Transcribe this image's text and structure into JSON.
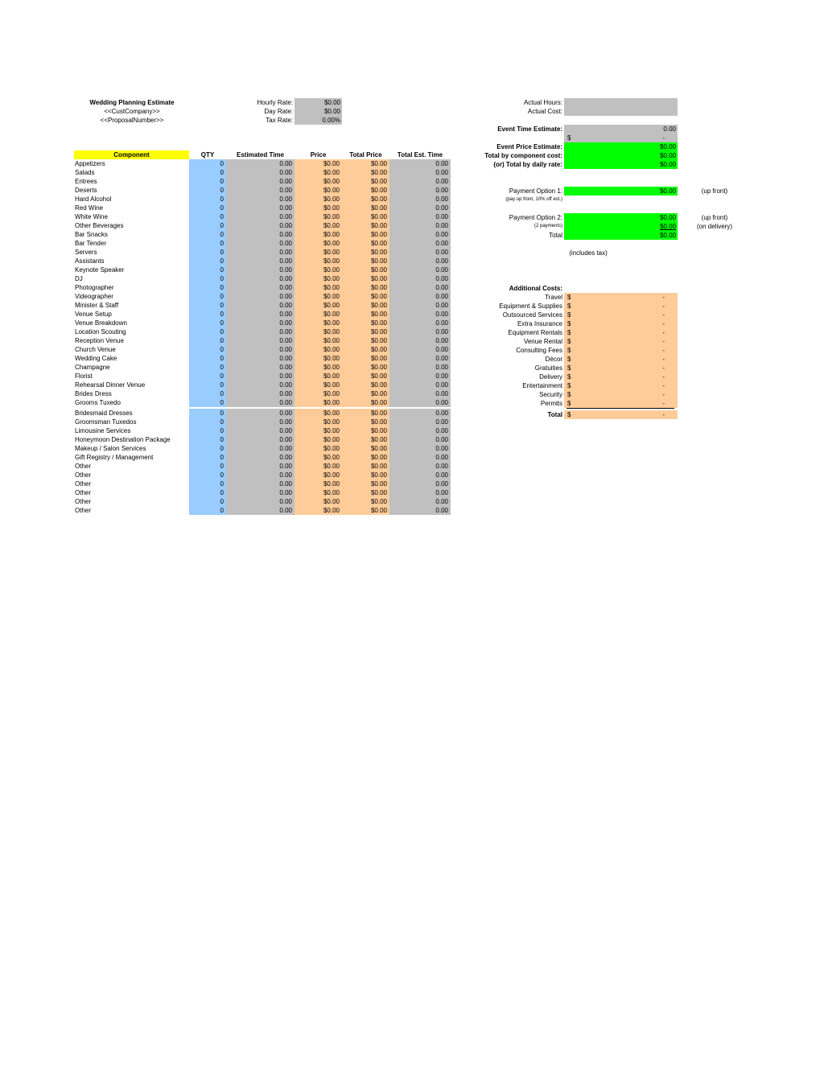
{
  "header": {
    "title": "Wedding Planning Estimate",
    "company": "<<CustCompany>>",
    "proposal": "<<ProposalNumber>>"
  },
  "rates": [
    {
      "label": "Hourly Rate:",
      "value": "$0.00"
    },
    {
      "label": "Day Rate:",
      "value": "$0.00"
    },
    {
      "label": "Tax Rate:",
      "value": "0.00%"
    }
  ],
  "table": {
    "columns": [
      "Component",
      "QTY",
      "Estimated Time",
      "Price",
      "Total Price",
      "Total Est. Time"
    ],
    "rows": [
      {
        "component": "Appetizers",
        "qty": "0",
        "est_time": "0.00",
        "price": "$0.00",
        "total_price": "$0.00",
        "total_est_time": "0.00"
      },
      {
        "component": "Salads",
        "qty": "0",
        "est_time": "0.00",
        "price": "$0.00",
        "total_price": "$0.00",
        "total_est_time": "0.00"
      },
      {
        "component": "Entrees",
        "qty": "0",
        "est_time": "0.00",
        "price": "$0.00",
        "total_price": "$0.00",
        "total_est_time": "0.00"
      },
      {
        "component": "Deserts",
        "qty": "0",
        "est_time": "0.00",
        "price": "$0.00",
        "total_price": "$0.00",
        "total_est_time": "0.00"
      },
      {
        "component": "Hard Alcohol",
        "qty": "0",
        "est_time": "0.00",
        "price": "$0.00",
        "total_price": "$0.00",
        "total_est_time": "0.00"
      },
      {
        "component": "Red Wine",
        "qty": "0",
        "est_time": "0.00",
        "price": "$0.00",
        "total_price": "$0.00",
        "total_est_time": "0.00"
      },
      {
        "component": "White Wine",
        "qty": "0",
        "est_time": "0.00",
        "price": "$0.00",
        "total_price": "$0.00",
        "total_est_time": "0.00"
      },
      {
        "component": "Other Beverages",
        "qty": "0",
        "est_time": "0.00",
        "price": "$0.00",
        "total_price": "$0.00",
        "total_est_time": "0.00"
      },
      {
        "component": "Bar Snacks",
        "qty": "0",
        "est_time": "0.00",
        "price": "$0.00",
        "total_price": "$0.00",
        "total_est_time": "0.00"
      },
      {
        "component": "Bar Tender",
        "qty": "0",
        "est_time": "0.00",
        "price": "$0.00",
        "total_price": "$0.00",
        "total_est_time": "0.00"
      },
      {
        "component": "Servers",
        "qty": "0",
        "est_time": "0.00",
        "price": "$0.00",
        "total_price": "$0.00",
        "total_est_time": "0.00"
      },
      {
        "component": "Assistants",
        "qty": "0",
        "est_time": "0.00",
        "price": "$0.00",
        "total_price": "$0.00",
        "total_est_time": "0.00"
      },
      {
        "component": "Keynote Speaker",
        "qty": "0",
        "est_time": "0.00",
        "price": "$0.00",
        "total_price": "$0.00",
        "total_est_time": "0.00"
      },
      {
        "component": "DJ",
        "qty": "0",
        "est_time": "0.00",
        "price": "$0.00",
        "total_price": "$0.00",
        "total_est_time": "0.00"
      },
      {
        "component": "Photographer",
        "qty": "0",
        "est_time": "0.00",
        "price": "$0.00",
        "total_price": "$0.00",
        "total_est_time": "0.00"
      },
      {
        "component": "Videographer",
        "qty": "0",
        "est_time": "0.00",
        "price": "$0.00",
        "total_price": "$0.00",
        "total_est_time": "0.00"
      },
      {
        "component": "Minister & Staff",
        "qty": "0",
        "est_time": "0.00",
        "price": "$0.00",
        "total_price": "$0.00",
        "total_est_time": "0.00"
      },
      {
        "component": "Venue Setup",
        "qty": "0",
        "est_time": "0.00",
        "price": "$0.00",
        "total_price": "$0.00",
        "total_est_time": "0.00"
      },
      {
        "component": "Venue Breakdown",
        "qty": "0",
        "est_time": "0.00",
        "price": "$0.00",
        "total_price": "$0.00",
        "total_est_time": "0.00"
      },
      {
        "component": "Location Scouting",
        "qty": "0",
        "est_time": "0.00",
        "price": "$0.00",
        "total_price": "$0.00",
        "total_est_time": "0.00"
      },
      {
        "component": "Reception Venue",
        "qty": "0",
        "est_time": "0.00",
        "price": "$0.00",
        "total_price": "$0.00",
        "total_est_time": "0.00"
      },
      {
        "component": "Church Venue",
        "qty": "0",
        "est_time": "0.00",
        "price": "$0.00",
        "total_price": "$0.00",
        "total_est_time": "0.00"
      },
      {
        "component": "Wedding Cake",
        "qty": "0",
        "est_time": "0.00",
        "price": "$0.00",
        "total_price": "$0.00",
        "total_est_time": "0.00"
      },
      {
        "component": "Champagne",
        "qty": "0",
        "est_time": "0.00",
        "price": "$0.00",
        "total_price": "$0.00",
        "total_est_time": "0.00"
      },
      {
        "component": "Florist",
        "qty": "0",
        "est_time": "0.00",
        "price": "$0.00",
        "total_price": "$0.00",
        "total_est_time": "0.00"
      },
      {
        "component": "Rehearsal Dinner Venue",
        "qty": "0",
        "est_time": "0.00",
        "price": "$0.00",
        "total_price": "$0.00",
        "total_est_time": "0.00"
      },
      {
        "component": "Brides Dress",
        "qty": "0",
        "est_time": "0.00",
        "price": "$0.00",
        "total_price": "$0.00",
        "total_est_time": "0.00"
      },
      {
        "component": "Grooms Tuxedo",
        "qty": "0",
        "est_time": "0.00",
        "price": "$0.00",
        "total_price": "$0.00",
        "total_est_time": "0.00"
      },
      {
        "component": "Bridesmaid Dresses",
        "qty": "0",
        "est_time": "0.00",
        "price": "$0.00",
        "total_price": "$0.00",
        "total_est_time": "0.00"
      },
      {
        "component": "Groomsman Tuxedos",
        "qty": "0",
        "est_time": "0.00",
        "price": "$0.00",
        "total_price": "$0.00",
        "total_est_time": "0.00"
      },
      {
        "component": "Limousine Services",
        "qty": "0",
        "est_time": "0.00",
        "price": "$0.00",
        "total_price": "$0.00",
        "total_est_time": "0.00"
      },
      {
        "component": "Honeymoon Destination Package",
        "qty": "0",
        "est_time": "0.00",
        "price": "$0.00",
        "total_price": "$0.00",
        "total_est_time": "0.00"
      },
      {
        "component": "Makeup / Salon Services",
        "qty": "0",
        "est_time": "0.00",
        "price": "$0.00",
        "total_price": "$0.00",
        "total_est_time": "0.00"
      },
      {
        "component": "Gift Registry / Management",
        "qty": "0",
        "est_time": "0.00",
        "price": "$0.00",
        "total_price": "$0.00",
        "total_est_time": "0.00"
      },
      {
        "component": "Other",
        "qty": "0",
        "est_time": "0.00",
        "price": "$0.00",
        "total_price": "$0.00",
        "total_est_time": "0.00"
      },
      {
        "component": "Other",
        "qty": "0",
        "est_time": "0.00",
        "price": "$0.00",
        "total_price": "$0.00",
        "total_est_time": "0.00"
      },
      {
        "component": "Other",
        "qty": "0",
        "est_time": "0.00",
        "price": "$0.00",
        "total_price": "$0.00",
        "total_est_time": "0.00"
      },
      {
        "component": "Other",
        "qty": "0",
        "est_time": "0.00",
        "price": "$0.00",
        "total_price": "$0.00",
        "total_est_time": "0.00"
      },
      {
        "component": "Other",
        "qty": "0",
        "est_time": "0.00",
        "price": "$0.00",
        "total_price": "$0.00",
        "total_est_time": "0.00"
      },
      {
        "component": "Other",
        "qty": "0",
        "est_time": "0.00",
        "price": "$0.00",
        "total_price": "$0.00",
        "total_est_time": "0.00"
      }
    ]
  },
  "actuals": {
    "hours_label": "Actual Hours:",
    "hours_value": "",
    "cost_label": "Actual Cost:",
    "cost_value": ""
  },
  "estimates": {
    "time_label": "Event Time Estimate:",
    "time_value": "0.00",
    "time_cost_currency": "$",
    "time_cost_value": "-",
    "price_label": "Event Price Estimate:",
    "price_value": "$0.00",
    "by_component_label": "Total by component cost:",
    "by_component_value": "$0.00",
    "by_daily_label": "(or) Total by daily rate:",
    "by_daily_value": "$0.00"
  },
  "payments": {
    "option1_label": "Payment Option 1:",
    "option1_sub": "(pay up front, 10% off est.)",
    "option1_value": "$0.00",
    "option1_note": "(up front)",
    "option2_label": "Payment Option 2:",
    "option2_sub": "(2 payments)",
    "option2_value1": "$0.00",
    "option2_note1": "(up front)",
    "option2_value2": "$0.00",
    "option2_note2": "(on delivery)",
    "total_label": "Total",
    "total_value": "$0.00",
    "tax_note": "(includes tax)"
  },
  "additional_costs": {
    "title": "Additional Costs:",
    "currency": "$",
    "items": [
      {
        "label": "Travel",
        "value": "-"
      },
      {
        "label": "Equipment & Supplies",
        "value": "-"
      },
      {
        "label": "Outsourced Services",
        "value": "-"
      },
      {
        "label": "Extra Insurance",
        "value": "-"
      },
      {
        "label": "Equipment Rentals",
        "value": "-"
      },
      {
        "label": "Venue Rental",
        "value": "-"
      },
      {
        "label": "Consulting Fees",
        "value": "-"
      },
      {
        "label": "Décor",
        "value": "-"
      },
      {
        "label": "Gratuities",
        "value": "-"
      },
      {
        "label": "Delivery",
        "value": "-"
      },
      {
        "label": "Entertainment",
        "value": "-"
      },
      {
        "label": "Security",
        "value": "-"
      },
      {
        "label": "Permits",
        "value": "-"
      }
    ],
    "total_label": "Total",
    "total_value": "-"
  },
  "colors": {
    "header_yellow": "#ffff00",
    "qty_blue": "#99ccff",
    "gray_fill": "#c0c0c0",
    "price_peach": "#ffcc99",
    "estimate_green": "#00ff00"
  }
}
